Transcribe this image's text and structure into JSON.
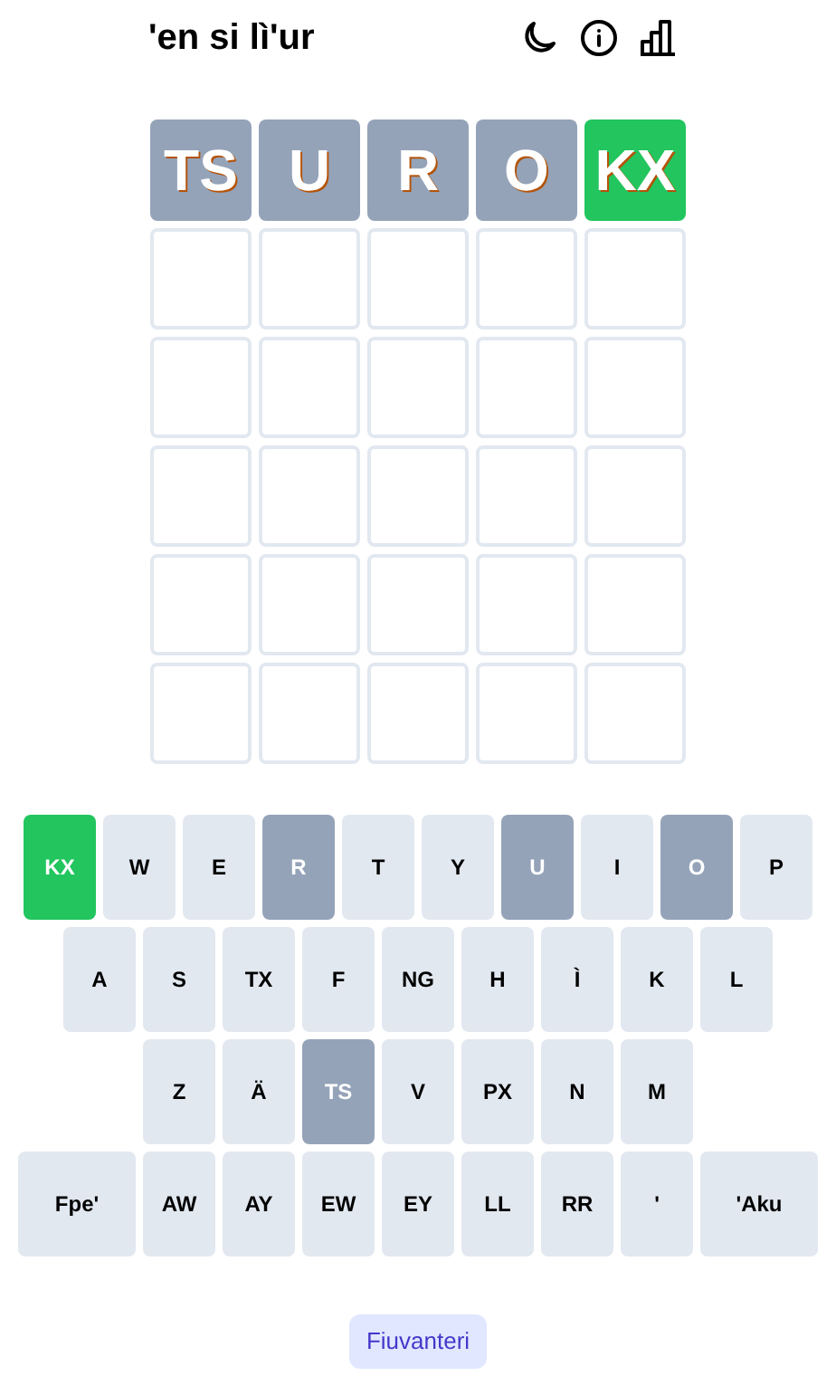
{
  "header": {
    "title": "'en si lì'ur"
  },
  "board": [
    [
      {
        "letter": "TS",
        "filled": true,
        "correct": false
      },
      {
        "letter": "U",
        "filled": true,
        "correct": false
      },
      {
        "letter": "R",
        "filled": true,
        "correct": false
      },
      {
        "letter": "O",
        "filled": true,
        "correct": false
      },
      {
        "letter": "KX",
        "filled": true,
        "correct": true
      }
    ],
    [
      {
        "filled": false
      },
      {
        "filled": false
      },
      {
        "filled": false
      },
      {
        "filled": false
      },
      {
        "filled": false
      }
    ],
    [
      {
        "filled": false
      },
      {
        "filled": false
      },
      {
        "filled": false
      },
      {
        "filled": false
      },
      {
        "filled": false
      }
    ],
    [
      {
        "filled": false
      },
      {
        "filled": false
      },
      {
        "filled": false
      },
      {
        "filled": false
      },
      {
        "filled": false
      }
    ],
    [
      {
        "filled": false
      },
      {
        "filled": false
      },
      {
        "filled": false
      },
      {
        "filled": false
      },
      {
        "filled": false
      }
    ],
    [
      {
        "filled": false
      },
      {
        "filled": false
      },
      {
        "filled": false
      },
      {
        "filled": false
      },
      {
        "filled": false
      }
    ]
  ],
  "keyboard": [
    [
      {
        "label": "KX",
        "correct": true,
        "absent": false
      },
      {
        "label": "W",
        "correct": false,
        "absent": false
      },
      {
        "label": "E",
        "correct": false,
        "absent": false
      },
      {
        "label": "R",
        "correct": false,
        "absent": true
      },
      {
        "label": "T",
        "correct": false,
        "absent": false
      },
      {
        "label": "Y",
        "correct": false,
        "absent": false
      },
      {
        "label": "U",
        "correct": false,
        "absent": true
      },
      {
        "label": "I",
        "correct": false,
        "absent": false
      },
      {
        "label": "O",
        "correct": false,
        "absent": true
      },
      {
        "label": "P",
        "correct": false,
        "absent": false
      }
    ],
    [
      {
        "label": "A",
        "correct": false,
        "absent": false
      },
      {
        "label": "S",
        "correct": false,
        "absent": false
      },
      {
        "label": "TX",
        "correct": false,
        "absent": false
      },
      {
        "label": "F",
        "correct": false,
        "absent": false
      },
      {
        "label": "NG",
        "correct": false,
        "absent": false
      },
      {
        "label": "H",
        "correct": false,
        "absent": false
      },
      {
        "label": "Ì",
        "correct": false,
        "absent": false
      },
      {
        "label": "K",
        "correct": false,
        "absent": false
      },
      {
        "label": "L",
        "correct": false,
        "absent": false
      }
    ],
    [
      {
        "label": "Z",
        "correct": false,
        "absent": false
      },
      {
        "label": "Ä",
        "correct": false,
        "absent": false
      },
      {
        "label": "TS",
        "correct": false,
        "absent": true
      },
      {
        "label": "V",
        "correct": false,
        "absent": false
      },
      {
        "label": "PX",
        "correct": false,
        "absent": false
      },
      {
        "label": "N",
        "correct": false,
        "absent": false
      },
      {
        "label": "M",
        "correct": false,
        "absent": false
      }
    ],
    [
      {
        "label": "Fpe'",
        "correct": false,
        "absent": false,
        "wide": true
      },
      {
        "label": "AW",
        "correct": false,
        "absent": false,
        "wide": false
      },
      {
        "label": "AY",
        "correct": false,
        "absent": false,
        "wide": false
      },
      {
        "label": "EW",
        "correct": false,
        "absent": false,
        "wide": false
      },
      {
        "label": "EY",
        "correct": false,
        "absent": false,
        "wide": false
      },
      {
        "label": "LL",
        "correct": false,
        "absent": false,
        "wide": false
      },
      {
        "label": "RR",
        "correct": false,
        "absent": false,
        "wide": false
      },
      {
        "label": "'",
        "correct": false,
        "absent": false,
        "wide": false
      },
      {
        "label": "'Aku",
        "correct": false,
        "absent": false,
        "wide": true
      }
    ]
  ],
  "footer_button": {
    "label": "Fiuvanteri"
  }
}
